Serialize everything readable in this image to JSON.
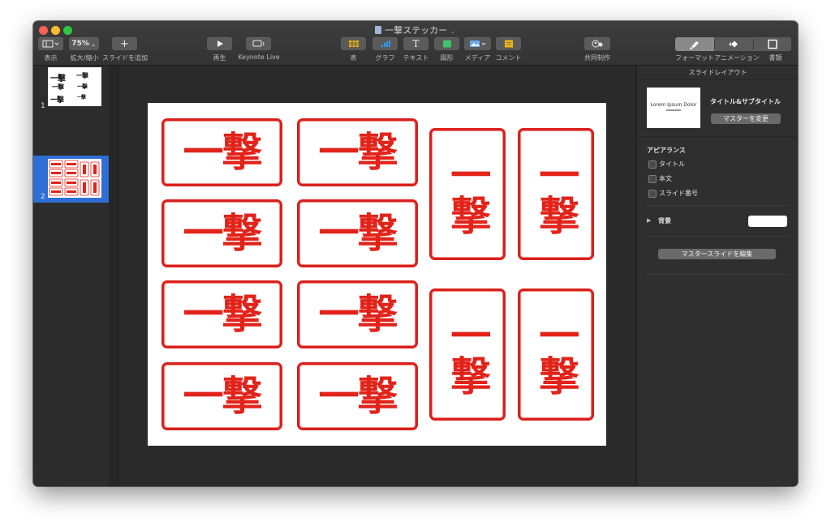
{
  "window": {
    "title": "一撃ステッカー"
  },
  "toolbar": {
    "view": {
      "label": "表示"
    },
    "zoom": {
      "value": "75%",
      "label": "拡大/縮小"
    },
    "add_slide": {
      "label": "スライドを追加"
    },
    "play": {
      "label": "再生"
    },
    "keynote_live": {
      "label": "Keynote Live"
    },
    "table": {
      "label": "表"
    },
    "chart": {
      "label": "グラフ"
    },
    "text": {
      "label": "テキスト"
    },
    "shape": {
      "label": "図形"
    },
    "media": {
      "label": "メディア"
    },
    "comment": {
      "label": "コメント"
    },
    "collaborate": {
      "label": "共同制作"
    },
    "format": {
      "label": "フォーマット"
    },
    "animate": {
      "label": "アニメーション"
    },
    "document": {
      "label": "書類"
    }
  },
  "colors": {
    "accent": "#2e6fd6",
    "stamp_red": "#e2231a",
    "toolbar_button": "#5a5a5a"
  },
  "slides": [
    {
      "number": "1",
      "selected": false,
      "thumb_lines": [
        "一撃",
        "一撃",
        "一撃",
        "一撃",
        "一撃",
        "一撃"
      ]
    },
    {
      "number": "2",
      "selected": true
    }
  ],
  "stamps": [
    "一撃",
    "一撃",
    "一撃",
    "一撃",
    "一撃",
    "一撃",
    "一撃",
    "一撃",
    "一撃",
    "一撃",
    "一撃",
    "一撃"
  ],
  "inspector": {
    "header": "スライドレイアウト",
    "layout_name": "タイトル&サブタイトル",
    "layout_preview_text": "Lorem Ipsum Dolor",
    "change_master_button": "マスターを変更",
    "appearance_title": "アピアランス",
    "checkboxes": [
      {
        "label": "タイトル",
        "checked": false
      },
      {
        "label": "本文",
        "checked": false
      },
      {
        "label": "スライド番号",
        "checked": false
      }
    ],
    "background_label": "背景",
    "background_color": "#ffffff",
    "edit_master_button": "マスタースライドを編集"
  }
}
